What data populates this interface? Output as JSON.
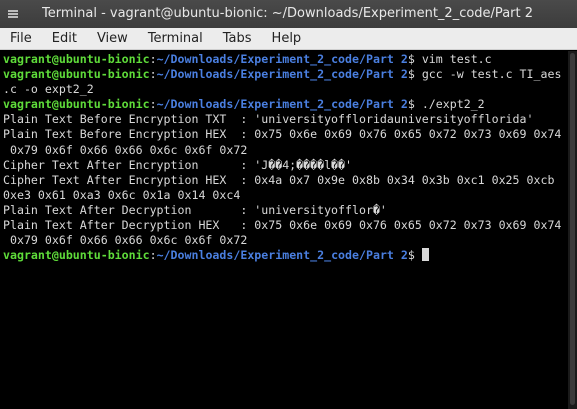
{
  "window": {
    "title": "Terminal - vagrant@ubuntu-bionic: ~/Downloads/Experiment_2_code/Part 2"
  },
  "menubar": {
    "items": [
      "File",
      "Edit",
      "View",
      "Terminal",
      "Tabs",
      "Help"
    ]
  },
  "terminal": {
    "prompt_user": "vagrant@ubuntu-bionic",
    "prompt_path": "~/Downloads/Experiment_2_code/Part 2",
    "commands": [
      "vim test.c",
      "gcc -w test.c TI_aes.c -o expt2_2",
      "./expt2_2",
      ""
    ],
    "cmd2_wrap_first": "gcc -w test.c TI_aes",
    "cmd2_wrap_second": ".c -o expt2_2",
    "output_lines": [
      "Plain Text Before Encryption TXT  : 'universityoffloridauniversityofflorida'",
      "Plain Text Before Encryption HEX  : 0x75 0x6e 0x69 0x76 0x65 0x72 0x73 0x69 0x74",
      " 0x79 0x6f 0x66 0x66 0x6c 0x6f 0x72",
      "Cipher Text After Encryption      : 'J��4;����l��'",
      "Cipher Text After Encryption HEX  : 0x4a 0x7 0x9e 0x8b 0x34 0x3b 0xc1 0x25 0xcb",
      "0xe3 0x61 0xa3 0x6c 0x1a 0x14 0xc4",
      "Plain Text After Decryption       : 'universityofflor�'",
      "Plain Text After Decryption HEX   : 0x75 0x6e 0x69 0x76 0x65 0x72 0x73 0x69 0x74",
      " 0x79 0x6f 0x66 0x66 0x6c 0x6f 0x72"
    ]
  }
}
